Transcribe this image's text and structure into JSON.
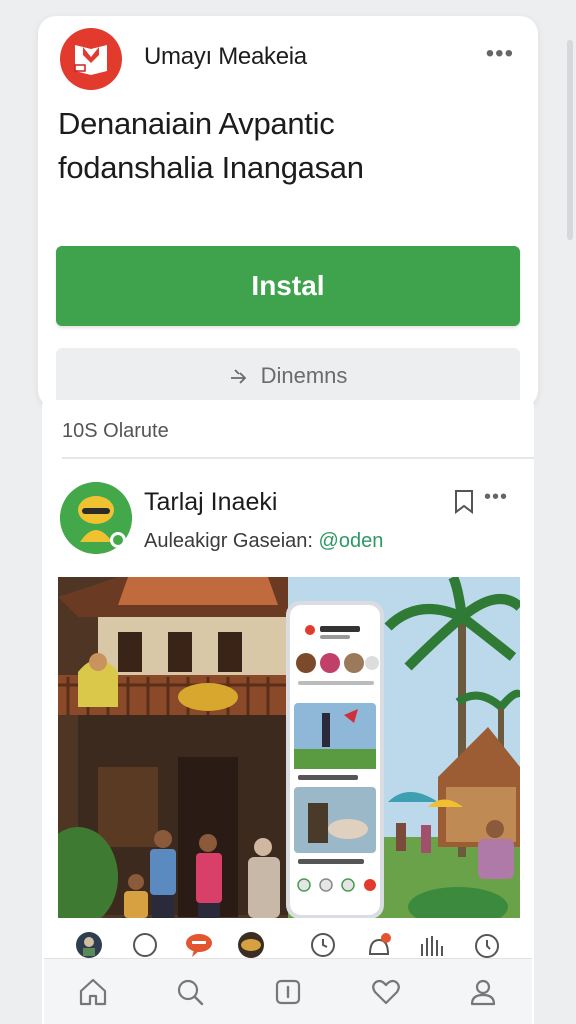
{
  "ad": {
    "app_name": "Umayı Meakeia",
    "title_line1": "Denanaiain Avpantic",
    "title_line2": "fodanshalia Inangasan",
    "install_label": "Instal",
    "details_label": "Dinemns",
    "brand_color": "#e23b2e",
    "install_color": "#3fa34d"
  },
  "feed": {
    "section_label": "10S Olarute",
    "post": {
      "author": "Tarlaj Inaeki",
      "subtitle": "Auleakigr Gaseian:",
      "handle": "@oden"
    },
    "reaction_icons": [
      "avatar-reaction",
      "speech-bubble-icon",
      "speech-bubble-red-icon",
      "avatar-reaction-2",
      "clock-icon",
      "notification-icon",
      "hand-icon",
      "timer-icon"
    ]
  },
  "bottom_nav": {
    "items": [
      "home-icon",
      "search-icon",
      "info-icon",
      "heart-icon",
      "profile-icon"
    ]
  }
}
